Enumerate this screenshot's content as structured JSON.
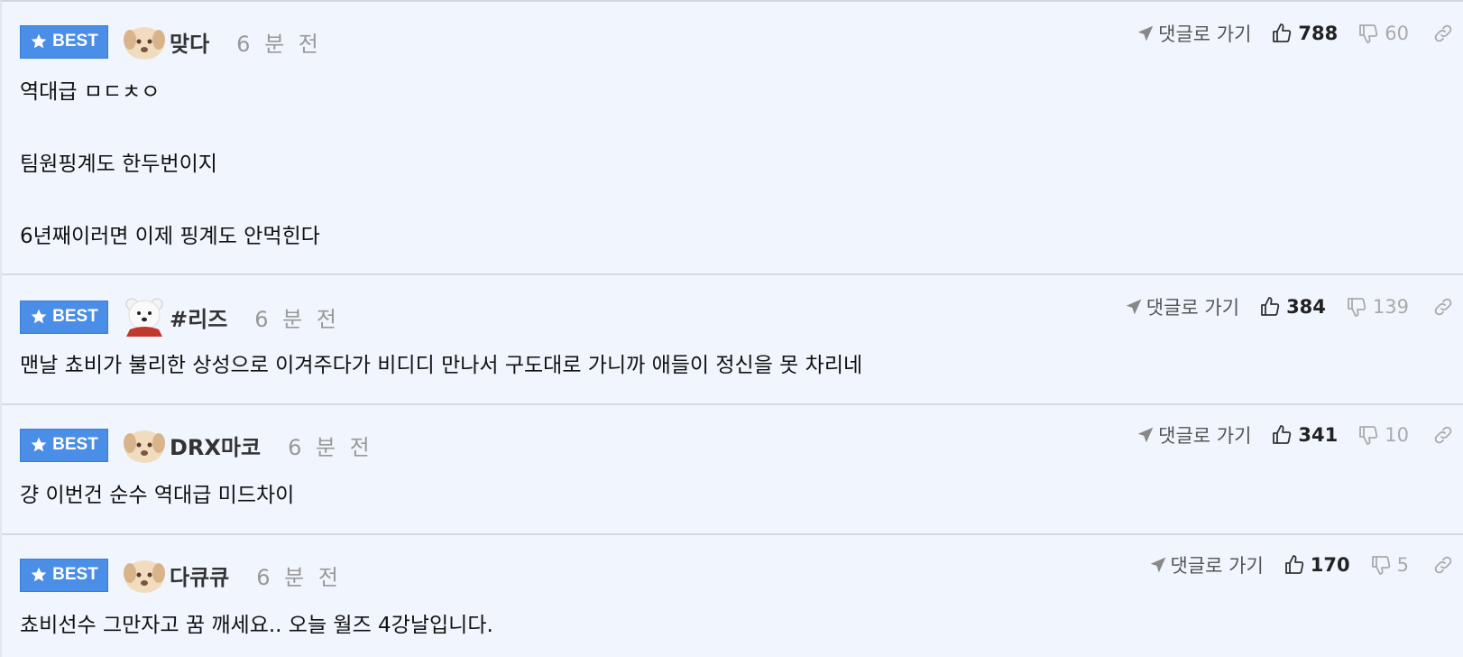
{
  "comments": [
    {
      "badge": "BEST",
      "nickname": "맞다",
      "time": "6 분 전",
      "avatar": "puppy-avatar",
      "body": "역대급 ㅁㄷㅊㅇ\n\n팀원핑계도 한두번이지\n\n6년째이러면 이제 핑계도 안먹힌다",
      "goto_label": "댓글로 가기",
      "upvotes": "788",
      "downvotes": "60"
    },
    {
      "badge": "BEST",
      "nickname": "#리즈",
      "time": "6 분 전",
      "avatar": "polar-bear-avatar",
      "body": "맨날 쵸비가 불리한 상성으로 이겨주다가 비디디 만나서 구도대로 가니까 애들이 정신을 못 차리네",
      "goto_label": "댓글로 가기",
      "upvotes": "384",
      "downvotes": "139"
    },
    {
      "badge": "BEST",
      "nickname": "DRX마코",
      "time": "6 분 전",
      "avatar": "puppy-avatar",
      "body": "걍 이번건 순수 역대급 미드차이",
      "goto_label": "댓글로 가기",
      "upvotes": "341",
      "downvotes": "10"
    },
    {
      "badge": "BEST",
      "nickname": "다큐큐",
      "time": "6 분 전",
      "avatar": "puppy-avatar",
      "body": "쵸비선수 그만자고 꿈 깨세요.. 오늘 월즈 4강날입니다.",
      "goto_label": "댓글로 가기",
      "upvotes": "170",
      "downvotes": "5"
    }
  ],
  "colors": {
    "background": "#f1f5fd",
    "badge": "#4a8ee8",
    "divider": "#d6d9de",
    "muted": "#999999"
  }
}
